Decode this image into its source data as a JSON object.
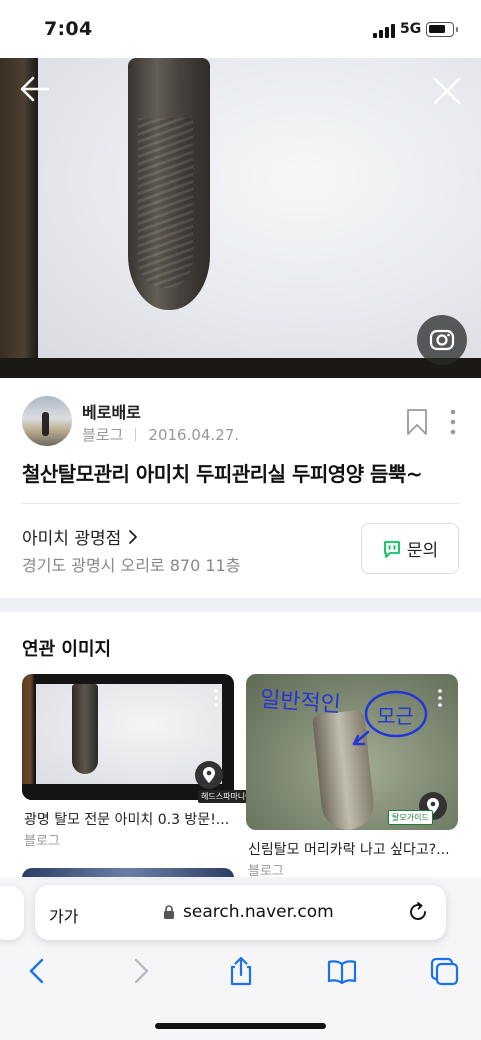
{
  "status_bar": {
    "time": "7:04",
    "network": "5G"
  },
  "post": {
    "author": "베로배로",
    "source": "블로그",
    "date": "2016.04.27.",
    "title": "철산탈모관리 아미치 두피관리실 두피영양 듬뿍~"
  },
  "place": {
    "name": "아미치 광명점",
    "address": "경기도 광명시 오리로 870 11층",
    "inquiry_label": "문의"
  },
  "related": {
    "title": "연관 이미지",
    "cards": [
      {
        "caption": "광명 탈모 전문 아미치 0.3 방문!...",
        "source": "블로그",
        "badge": "헤드스파마니아"
      },
      {
        "caption": "신림탈모 머리카락 나고 싶다고?...",
        "source": "블로그",
        "badge": "탈모가이드",
        "scribble_text": "일반적인",
        "scribble_circle": "모근"
      }
    ]
  },
  "browser": {
    "aa_label": "가가",
    "url": "search.naver.com"
  },
  "icons": {
    "back": "arrow-left-icon",
    "close": "close-icon",
    "lens": "camera-lens-icon",
    "bookmark": "bookmark-icon",
    "more": "more-vertical-icon",
    "talk": "talk-bubble-icon",
    "pin": "map-pin-icon",
    "lock": "lock-icon",
    "reload": "reload-icon",
    "nav_back": "chevron-left-icon",
    "nav_forward": "chevron-right-icon",
    "share": "share-icon",
    "bookmarks": "book-icon",
    "tabs": "tabs-icon"
  },
  "colors": {
    "accent_green": "#03c75a",
    "nav_blue": "#1a73e8",
    "muted_text": "#999999"
  }
}
